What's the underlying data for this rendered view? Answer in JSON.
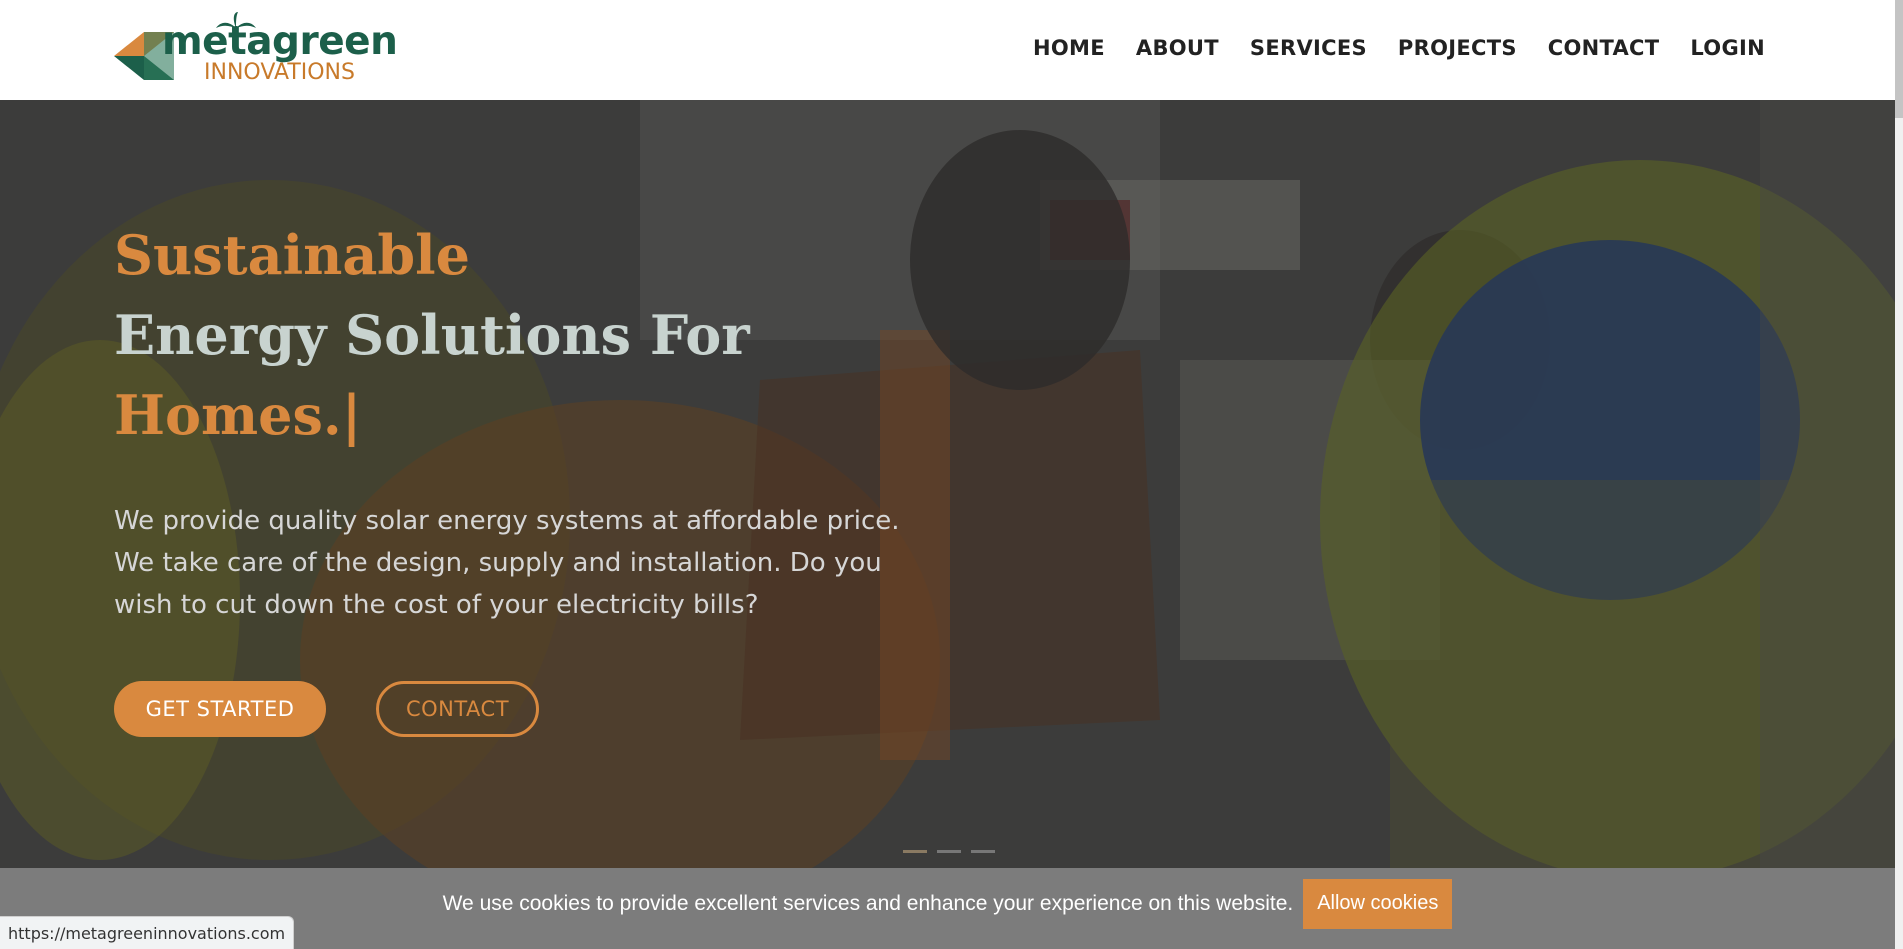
{
  "brand": {
    "logo_word": "metagreen",
    "logo_sub": "INNOVATIONS",
    "green": "#1c5f4a",
    "accent": "#d9893f"
  },
  "nav": {
    "items": [
      {
        "label": "HOME"
      },
      {
        "label": "ABOUT"
      },
      {
        "label": "SERVICES"
      },
      {
        "label": "PROJECTS"
      },
      {
        "label": "CONTACT"
      },
      {
        "label": "LOGIN"
      }
    ]
  },
  "hero": {
    "headline_line1": "Sustainable",
    "headline_line2": "Energy Solutions For",
    "headline_line3": "Homes.|",
    "description": "We provide quality solar energy systems at affordable price. We take care of the design, supply and installation. Do you wish to cut down the cost of your electricity bills?",
    "primary_button": "GET STARTED",
    "secondary_button": "CONTACT",
    "slide_count": 3,
    "active_slide": 1
  },
  "cookie": {
    "message": "We use cookies to provide excellent services and enhance your experience on this website.",
    "button": "Allow cookies"
  },
  "status_bar": {
    "url": "https://metagreeninnovations.com"
  }
}
